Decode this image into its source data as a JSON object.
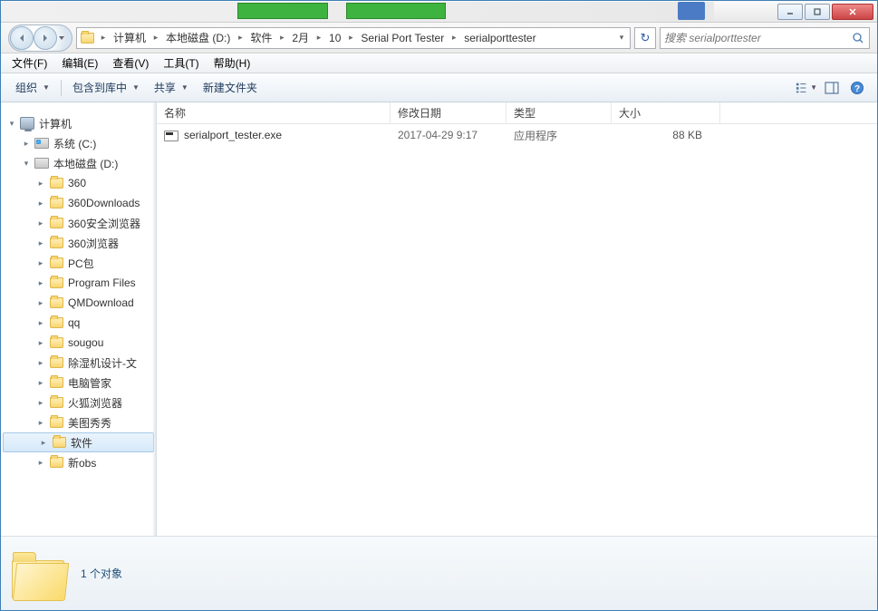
{
  "breadcrumb": {
    "segments": [
      "计算机",
      "本地磁盘 (D:)",
      "软件",
      "2月",
      "10",
      "Serial Port Tester",
      "serialporttester"
    ]
  },
  "search": {
    "placeholder": "搜索 serialporttester"
  },
  "menubar": {
    "file": "文件(F)",
    "edit": "编辑(E)",
    "view": "查看(V)",
    "tools": "工具(T)",
    "help": "帮助(H)"
  },
  "toolbar": {
    "organize": "组织",
    "include": "包含到库中",
    "share": "共享",
    "newfolder": "新建文件夹"
  },
  "sidebar": {
    "computer": "计算机",
    "drive_c": "系统 (C:)",
    "drive_d": "本地磁盘 (D:)",
    "folders": [
      "360",
      "360Downloads",
      "360安全浏览器",
      "360浏览器",
      "PC包",
      "Program Files",
      "QMDownload",
      "qq",
      "sougou",
      "除湿机设计-文",
      "电脑管家",
      "火狐浏览器",
      "美图秀秀",
      "软件",
      "新obs"
    ]
  },
  "columns": {
    "name": "名称",
    "date": "修改日期",
    "type": "类型",
    "size": "大小"
  },
  "rows": [
    {
      "name": "serialport_tester.exe",
      "date": "2017-04-29 9:17",
      "type": "应用程序",
      "size": "88 KB"
    }
  ],
  "status": {
    "count": "1 个对象"
  }
}
